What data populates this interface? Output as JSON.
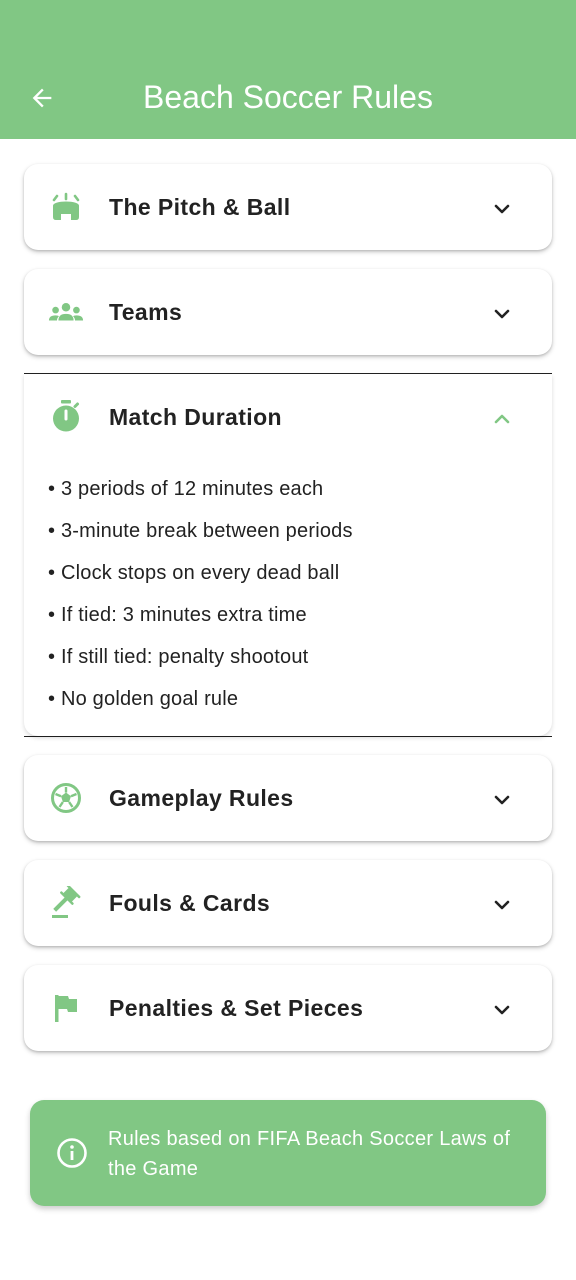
{
  "header": {
    "title": "Beach Soccer Rules",
    "back_icon": "arrow-left-icon"
  },
  "colors": {
    "accent": "#81c784",
    "text": "#222222"
  },
  "sections": [
    {
      "title": "The Pitch & Ball",
      "icon": "stadium-icon",
      "expanded": false
    },
    {
      "title": "Teams",
      "icon": "groups-icon",
      "expanded": false
    },
    {
      "title": "Match Duration",
      "icon": "timer-icon",
      "expanded": true,
      "items": [
        "• 3 periods of 12 minutes each",
        "• 3-minute break between periods",
        "• Clock stops on every dead ball",
        "• If tied: 3 minutes extra time",
        "• If still tied: penalty shootout",
        "• No golden goal rule"
      ]
    },
    {
      "title": "Gameplay Rules",
      "icon": "soccer-ball-icon",
      "expanded": false
    },
    {
      "title": "Fouls & Cards",
      "icon": "gavel-icon",
      "expanded": false
    },
    {
      "title": "Penalties & Set Pieces",
      "icon": "flag-icon",
      "expanded": false
    }
  ],
  "info": {
    "text": "Rules based on FIFA Beach Soccer Laws of the Game",
    "icon": "info-icon"
  }
}
